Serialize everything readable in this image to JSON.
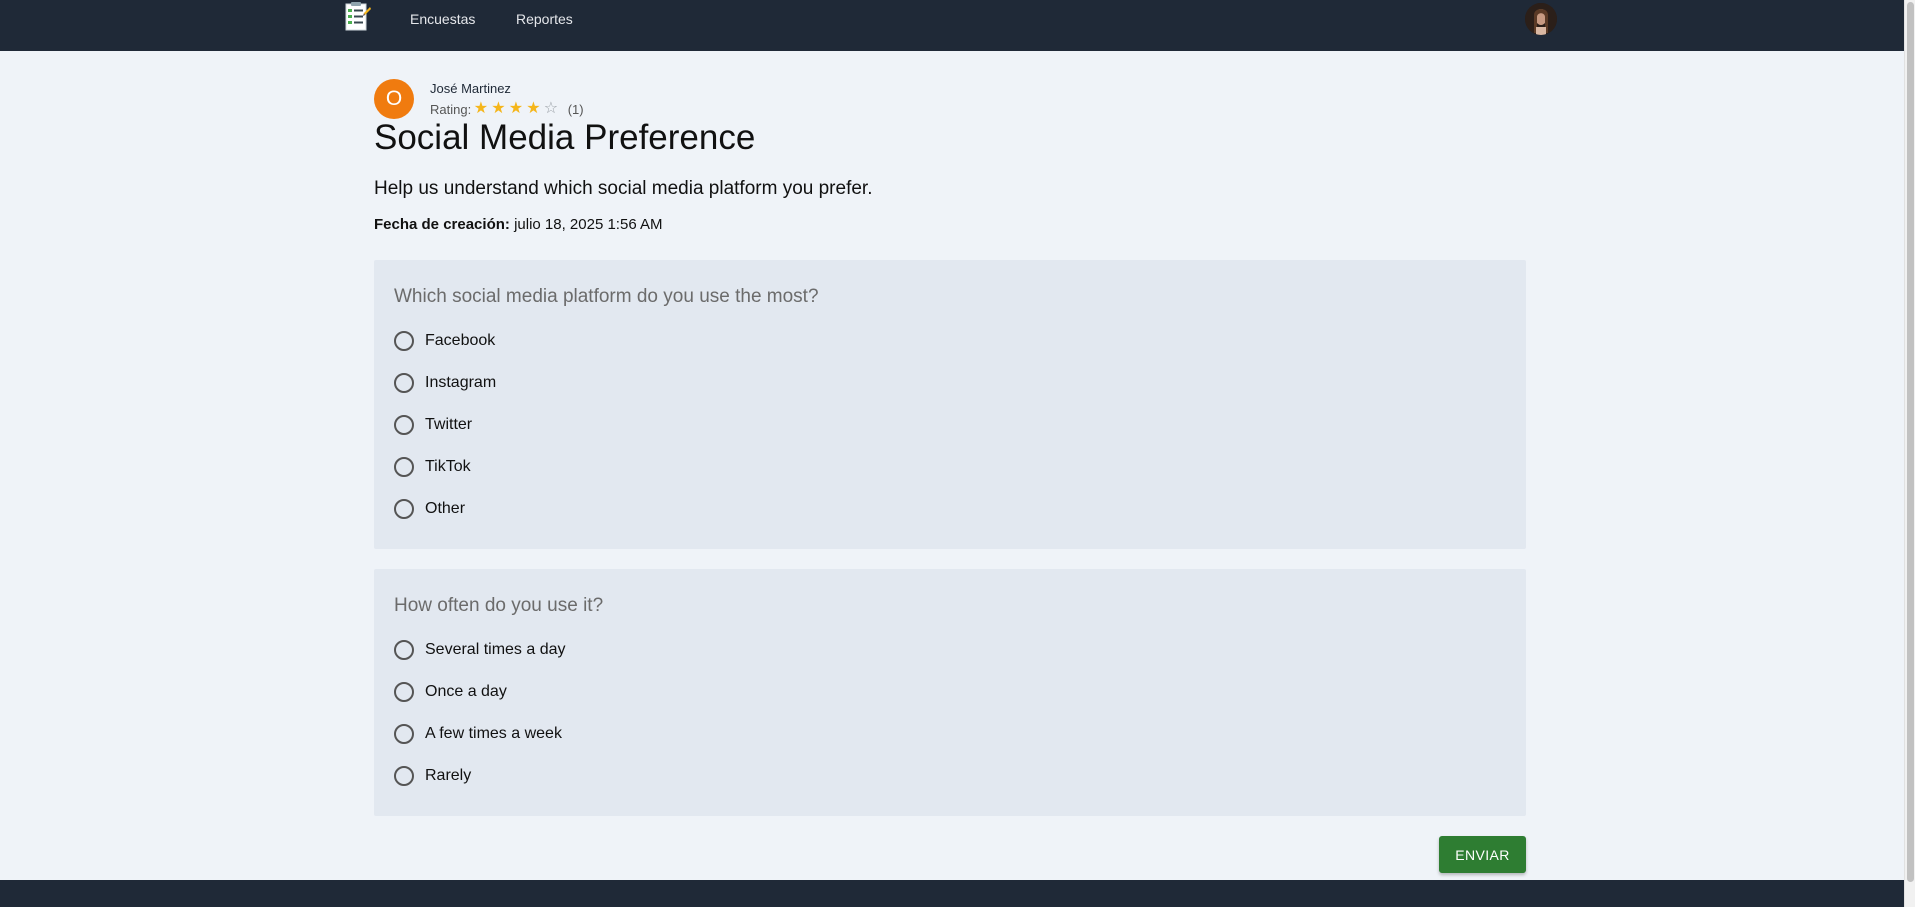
{
  "nav": {
    "links": [
      "Encuestas",
      "Reportes"
    ]
  },
  "author": {
    "initial": "O",
    "name": "José Martinez",
    "rating_label": "Rating:",
    "rating_value": 4,
    "rating_max": 5,
    "rating_count": "(1)"
  },
  "survey": {
    "title": "Social Media Preference",
    "description": "Help us understand which social media platform you prefer.",
    "created_label": "Fecha de creación:",
    "created_value": "julio 18, 2025 1:56 AM"
  },
  "questions": [
    {
      "text": "Which social media platform do you use the most?",
      "options": [
        "Facebook",
        "Instagram",
        "Twitter",
        "TikTok",
        "Other"
      ]
    },
    {
      "text": "How often do you use it?",
      "options": [
        "Several times a day",
        "Once a day",
        "A few times a week",
        "Rarely"
      ]
    }
  ],
  "submit_label": "ENVIAR",
  "colors": {
    "navbar": "#1f2937",
    "page_bg": "#eff3f8",
    "card_bg": "#e2e8f0",
    "avatar": "#f07b0f",
    "star": "#f5b61b",
    "submit": "#2e7d32"
  },
  "icons": {
    "logo": "survey-checklist-icon",
    "user": "user-avatar-photo",
    "star": "star-icon"
  }
}
